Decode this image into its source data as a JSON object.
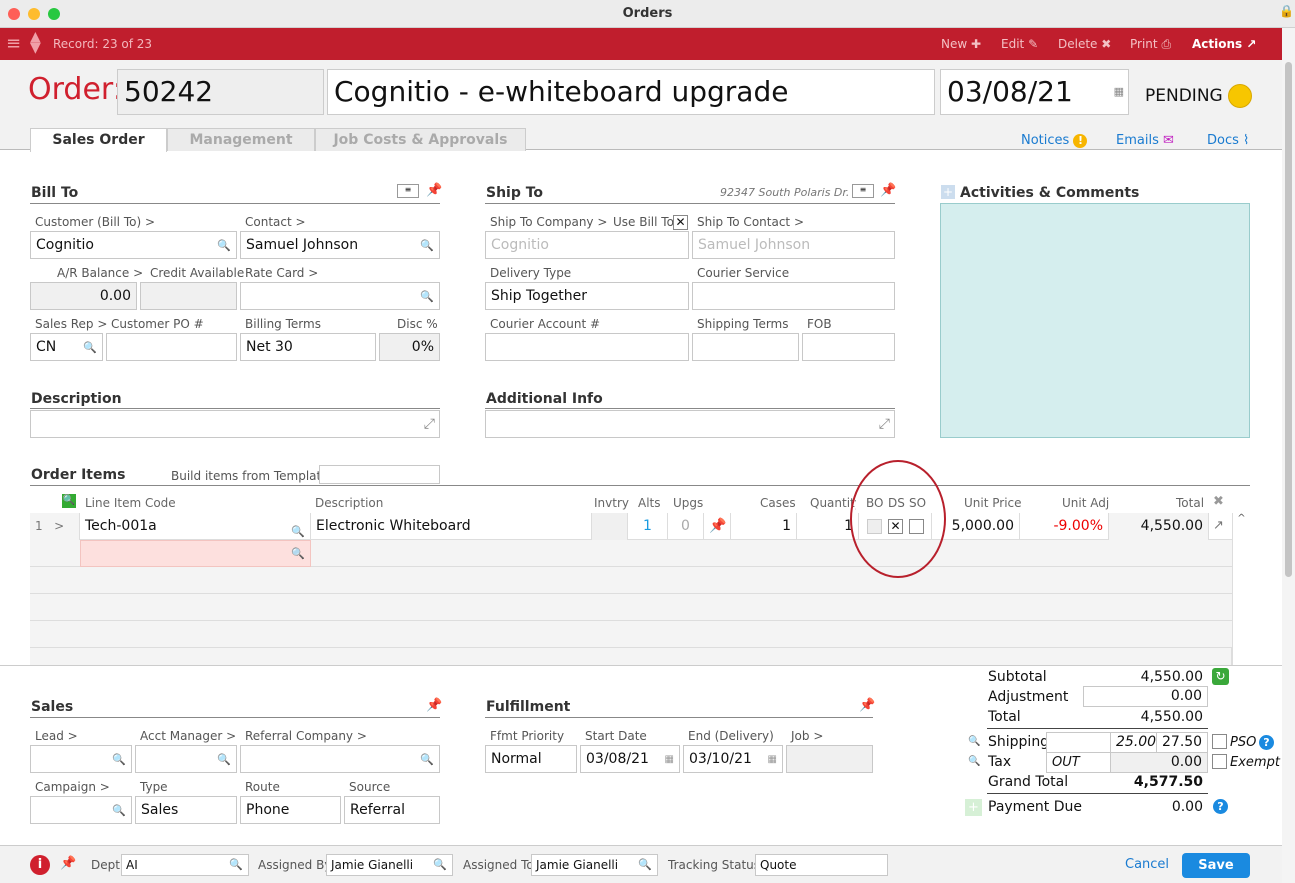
{
  "window": {
    "title": "Orders"
  },
  "toolbar": {
    "record": "Record: 23 of 23",
    "new": "New",
    "edit": "Edit",
    "delete": "Delete",
    "print": "Print",
    "actions": "Actions"
  },
  "header": {
    "order_label": "Order:",
    "order_number": "50242",
    "order_title": "Cognitio - e-whiteboard upgrade",
    "order_date": "03/08/21",
    "status": "PENDING",
    "status_color": "#f7c600"
  },
  "tabs": [
    {
      "label": "Sales Order"
    },
    {
      "label": "Management"
    },
    {
      "label": "Job Costs & Approvals"
    }
  ],
  "links": {
    "notices": "Notices",
    "emails": "Emails",
    "docs": "Docs"
  },
  "bill_to": {
    "title": "Bill To",
    "customer_label": "Customer (Bill To) >",
    "customer": "Cognitio",
    "contact_label": "Contact >",
    "contact": "Samuel Johnson",
    "ar_label": "A/R Balance >",
    "ar": "0.00",
    "credit_label": "Credit Available",
    "credit": "",
    "rate_label": "Rate Card >",
    "rate": "",
    "rep_label": "Sales Rep >",
    "rep": "CN",
    "po_label": "Customer PO #",
    "po": "",
    "terms_label": "Billing Terms",
    "terms": "Net 30",
    "disc_label": "Disc %",
    "disc": "0%"
  },
  "ship_to": {
    "title": "Ship To",
    "address": "92347 South Polaris Dr.",
    "company_label": "Ship To Company >",
    "use_bill_label": "Use Bill To",
    "use_bill_checked": "✕",
    "contact_label": "Ship To Contact >",
    "company": "Cognitio",
    "contact": "Samuel Johnson",
    "delivery_label": "Delivery Type",
    "delivery": "Ship Together",
    "courier_label": "Courier Service",
    "courier": "",
    "account_label": "Courier Account #",
    "account": "",
    "shipterms_label": "Shipping Terms",
    "shipterms": "",
    "fob_label": "FOB",
    "fob": ""
  },
  "activities": {
    "title": "Activities & Comments"
  },
  "description": {
    "title": "Description",
    "value": ""
  },
  "additional": {
    "title": "Additional Info",
    "value": ""
  },
  "items": {
    "title": "Order Items",
    "template_label": "Build items from Template:",
    "template": "",
    "columns": [
      "Line Item Code",
      "Description",
      "Invtry",
      "Alts",
      "Upgs",
      "Cases",
      "Quantity",
      "BO",
      "DS",
      "SO",
      "Unit Price",
      "Unit Adj",
      "Total"
    ],
    "rows": [
      {
        "num": "1",
        "code": "Tech-001a",
        "description": "Electronic Whiteboard",
        "invtry": "",
        "alts": "1",
        "upgs": "0",
        "cases": "1",
        "quantity": "1",
        "bo": false,
        "ds": "✕",
        "so": false,
        "unit_price": "5,000.00",
        "unit_adj": "-9.00%",
        "total": "4,550.00"
      }
    ]
  },
  "sales": {
    "title": "Sales",
    "lead_label": "Lead >",
    "acct_label": "Acct Manager >",
    "ref_label": "Referral Company >",
    "campaign_label": "Campaign >",
    "type_label": "Type",
    "type": "Sales",
    "route_label": "Route",
    "route": "Phone",
    "source_label": "Source",
    "source": "Referral"
  },
  "fulfillment": {
    "title": "Fulfillment",
    "priority_label": "Ffmt Priority",
    "priority": "Normal",
    "start_label": "Start Date",
    "start": "03/08/21",
    "end_label": "End (Delivery)",
    "end": "03/10/21",
    "job_label": "Job >",
    "job": ""
  },
  "totals": {
    "subtotal_label": "Subtotal",
    "subtotal": "4,550.00",
    "adjustment_label": "Adjustment",
    "adjustment": "0.00",
    "total_label": "Total",
    "total": "4,550.00",
    "shipping_label": "Shipping",
    "shipping_rate": "25.00",
    "shipping": "27.50",
    "pso_label": "PSO",
    "tax_label": "Tax",
    "tax_code": "OUT",
    "tax": "0.00",
    "exempt_label": "Exempt",
    "grand_label": "Grand Total",
    "grand": "4,577.50",
    "payment_label": "Payment Due",
    "payment": "0.00"
  },
  "footer": {
    "dept_label": "Dept",
    "dept": "AI",
    "assigned_by_label": "Assigned By",
    "assigned_by": "Jamie Gianelli",
    "assigned_to_label": "Assigned To",
    "assigned_to": "Jamie Gianelli",
    "tracking_label": "Tracking Status",
    "tracking": "Quote",
    "cancel": "Cancel",
    "save": "Save"
  }
}
